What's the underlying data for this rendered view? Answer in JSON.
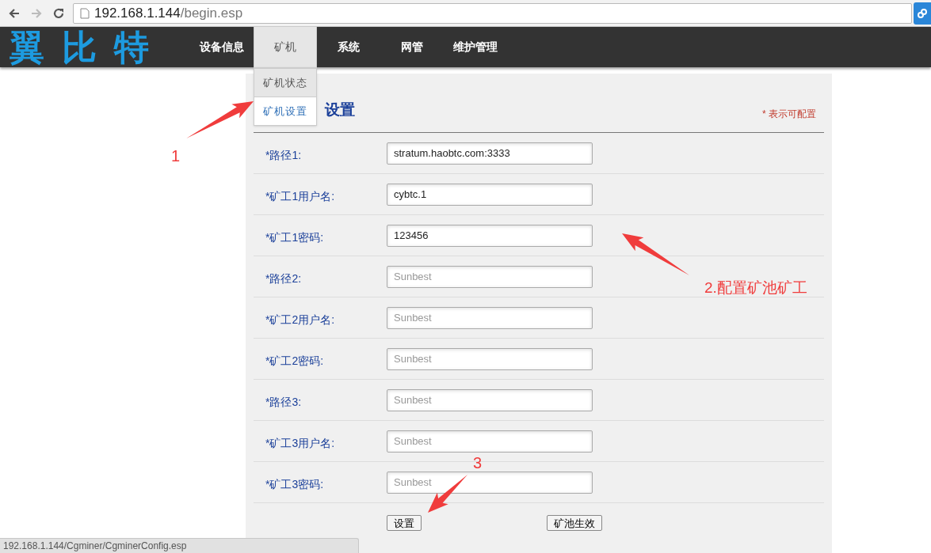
{
  "browser": {
    "url_host": "192.168.1.144",
    "url_path": "/begin.esp"
  },
  "header": {
    "logo": "翼比特",
    "nav": [
      {
        "label": "设备信息",
        "selected": false
      },
      {
        "label": "矿机",
        "selected": true,
        "menu": [
          {
            "label": "矿机状态",
            "selected": false
          },
          {
            "label": "矿机设置",
            "selected": true
          }
        ]
      },
      {
        "label": "系统",
        "selected": false
      },
      {
        "label": "网管",
        "selected": false
      },
      {
        "label": "维护管理",
        "selected": false
      }
    ]
  },
  "form": {
    "title": "设置",
    "note": "* 表示可配置",
    "rows": [
      {
        "label": "*路径1:",
        "value": "stratum.haobtc.com:3333"
      },
      {
        "label": "*矿工1用户名:",
        "value": "cybtc.1"
      },
      {
        "label": "*矿工1密码:",
        "value": "123456"
      },
      {
        "label": "*路径2:",
        "placeholder": "Sunbest"
      },
      {
        "label": "*矿工2用户名:",
        "placeholder": "Sunbest"
      },
      {
        "label": "*矿工2密码:",
        "placeholder": "Sunbest"
      },
      {
        "label": "*路径3:",
        "placeholder": "Sunbest"
      },
      {
        "label": "*矿工3用户名:",
        "placeholder": "Sunbest"
      },
      {
        "label": "*矿工3密码:",
        "placeholder": "Sunbest"
      }
    ],
    "buttons": [
      "设置",
      "矿池生效"
    ]
  },
  "annotations": [
    "1",
    "2.配置矿池矿工",
    "3"
  ],
  "status_bar": "192.168.1.144/Cgminer/CgminerConfig.esp"
}
